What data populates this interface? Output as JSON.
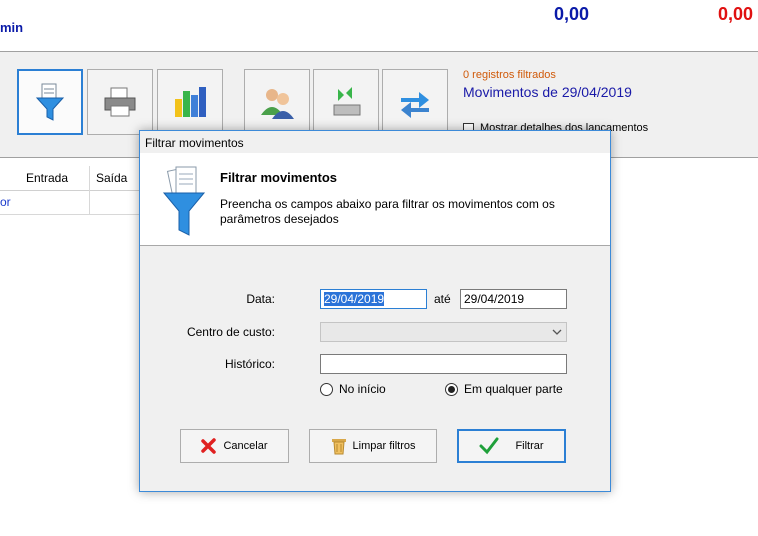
{
  "header": {
    "user": "min",
    "total_1": "0,00",
    "total_2": "0,00"
  },
  "toolbar": {
    "buttons": [
      {
        "icon": "funnel-icon"
      },
      {
        "icon": "printer-icon"
      },
      {
        "icon": "bar-chart-icon"
      },
      {
        "icon": "users-icon"
      },
      {
        "icon": "import-export-icon"
      },
      {
        "icon": "refresh-arrows-icon"
      }
    ],
    "filtered_count": "0 registros filtrados",
    "movements_title": "Movimentos de 29/04/2019",
    "show_details_label": "Mostrar detalhes dos lançamentos"
  },
  "grid": {
    "columns": [
      "Entrada",
      "Saída"
    ],
    "row_label": "or"
  },
  "dialog": {
    "window_title": "Filtrar movimentos",
    "heading": "Filtrar movimentos",
    "description": "Preencha os campos abaixo para filtrar os movimentos com os parâmetros desejados",
    "date_label": "Data:",
    "date_from": "29/04/2019",
    "until_label": "até",
    "date_to": "29/04/2019",
    "cost_center_label": "Centro de custo:",
    "cost_center_value": "",
    "history_label": "Histórico:",
    "history_value": "",
    "radio_start": "No início",
    "radio_anywhere": "Em qualquer parte",
    "btn_cancel": "Cancelar",
    "btn_clear": "Limpar filtros",
    "btn_filter": "Filtrar"
  },
  "colors": {
    "accent": "#2b7fd4",
    "total_blue": "#0a1aa8",
    "total_red": "#e01010",
    "filtered_orange": "#d05a0a"
  }
}
